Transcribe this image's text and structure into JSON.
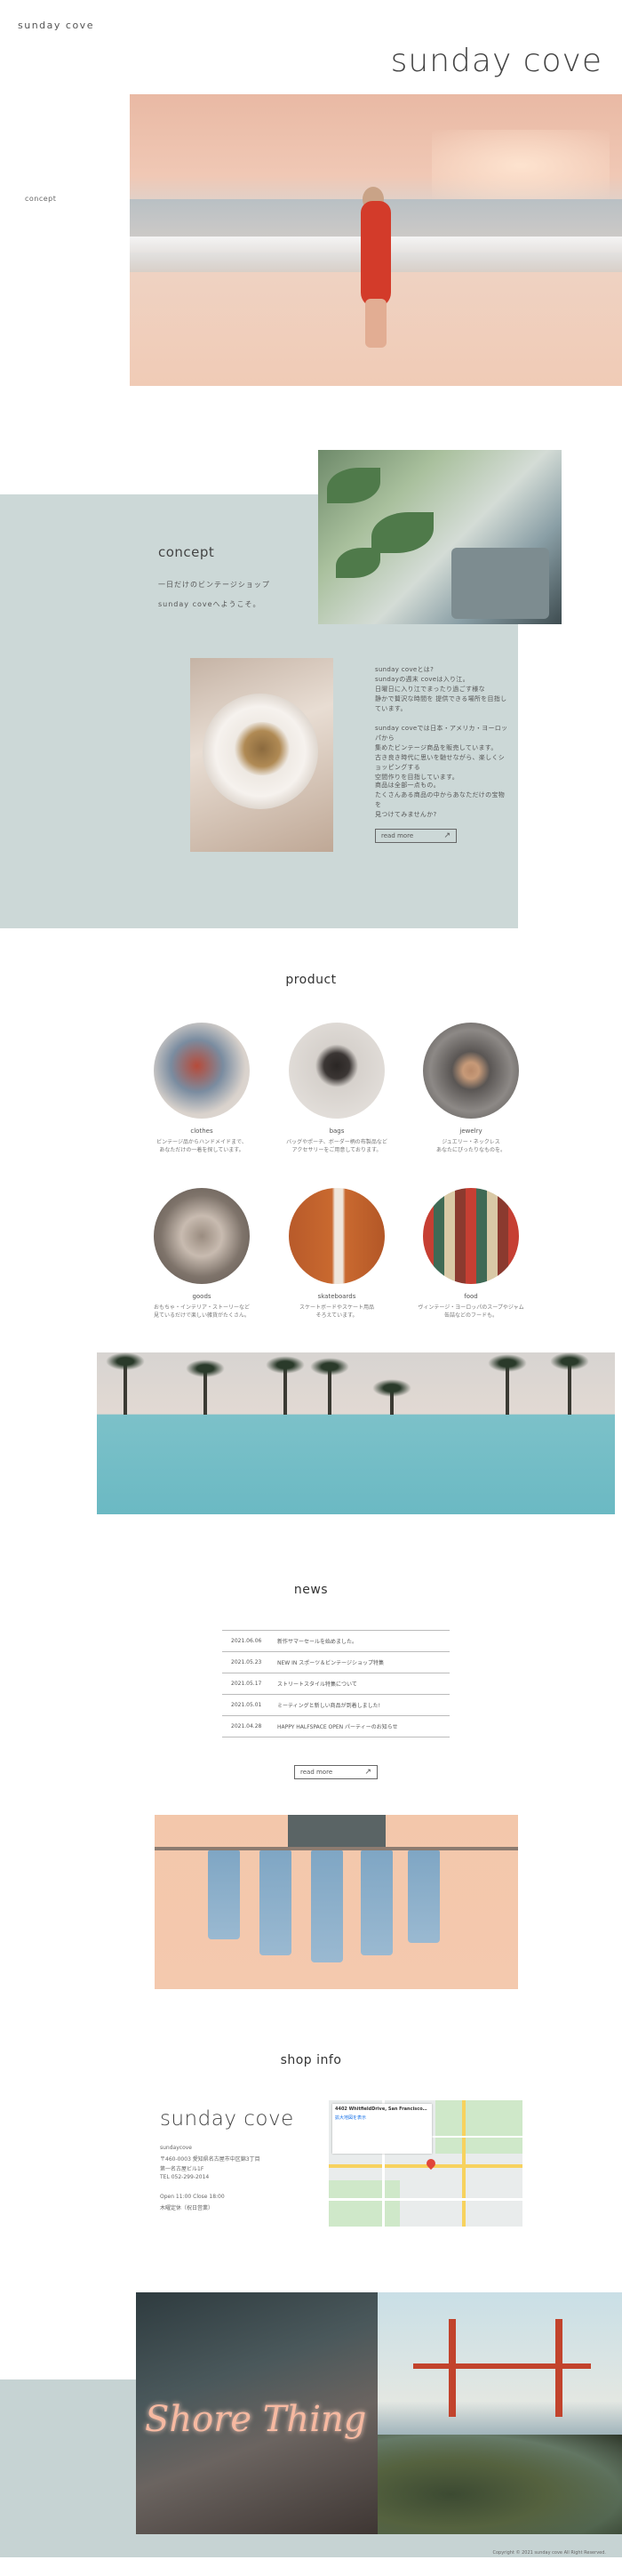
{
  "header": {
    "logo": "sunday cove",
    "title": "sunday cove",
    "side_label": "concept"
  },
  "concept": {
    "heading": "concept",
    "sub1": "一日だけのビンテージショップ",
    "sub2": "sunday coveへようこそ。",
    "paragraphs": [
      "sunday coveとは?",
      "sundayの週末 coveは入り江。",
      "日曜日に入り江でまったり過ごす様な",
      "静かで贅沢な時間を 提供できる場所を目指しています。",
      "sunday coveでは日本・アメリカ・ヨーロッパから",
      "集めたビンテージ商品を販売しています。",
      "古き良き時代に思いを馳せながら、楽しくショッピングする",
      "空間作りを目指しています。",
      "商品は全部一点もの。",
      "たくさんある商品の中からあなただけの宝物を",
      "見つけてみませんか?"
    ],
    "readmore": "read more"
  },
  "product": {
    "heading": "product",
    "items": [
      {
        "name": "clothes",
        "desc": "ビンテージ品からハンドメイドまで、\nあなただけの一着を探しています。"
      },
      {
        "name": "bags",
        "desc": "バッグやポーチ、ボーダー柄の布製品など\nアクセサリーをご用意しております。"
      },
      {
        "name": "jewelry",
        "desc": "ジュエリー・ネックレス\nあなたにぴったりなものを。"
      },
      {
        "name": "goods",
        "desc": "おもちゃ・インテリア・ストーリーなど\n見ているだけで楽しい雑貨がたくさん。"
      },
      {
        "name": "skateboards",
        "desc": "スケートボードやスケート用品\nそろえています。"
      },
      {
        "name": "food",
        "desc": "ヴィンテージ・ヨーロッパのスープやジャム\n缶詰などのフードも。"
      }
    ]
  },
  "news": {
    "heading": "news",
    "items": [
      {
        "date": "2021.06.06",
        "title": "新作サマーセールを始めました。"
      },
      {
        "date": "2021.05.23",
        "title": "NEW IN スポーツ＆ビンテージショップ特集"
      },
      {
        "date": "2021.05.17",
        "title": "ストリートスタイル特集について"
      },
      {
        "date": "2021.05.01",
        "title": "ミーティングと新しい商品が到着しました!"
      },
      {
        "date": "2021.04.28",
        "title": "HAPPY HALFSPACE OPEN パーティーのお知らせ"
      }
    ],
    "readmore": "read more"
  },
  "shop": {
    "heading": "shop info",
    "name": "sunday cove",
    "lines": [
      "sundaycove",
      "〒460-0003 愛知県名古屋市中区錦3丁目",
      "第一名古屋ビル1F",
      "TEL 052-299-2014",
      "",
      "Open 11:00 Close 18:00",
      "木曜定休（祝日営業）"
    ],
    "map_title": "4402 WhitfieldDrive, San Francisco…",
    "map_sub": "拡大地図を表示"
  },
  "footer": {
    "neon_text": "Shore Thing",
    "copyright": "Copyright © 2021 sunday cove All Right Reserved."
  },
  "colors": {
    "band": "#ccd8d7",
    "text": "#444444"
  }
}
